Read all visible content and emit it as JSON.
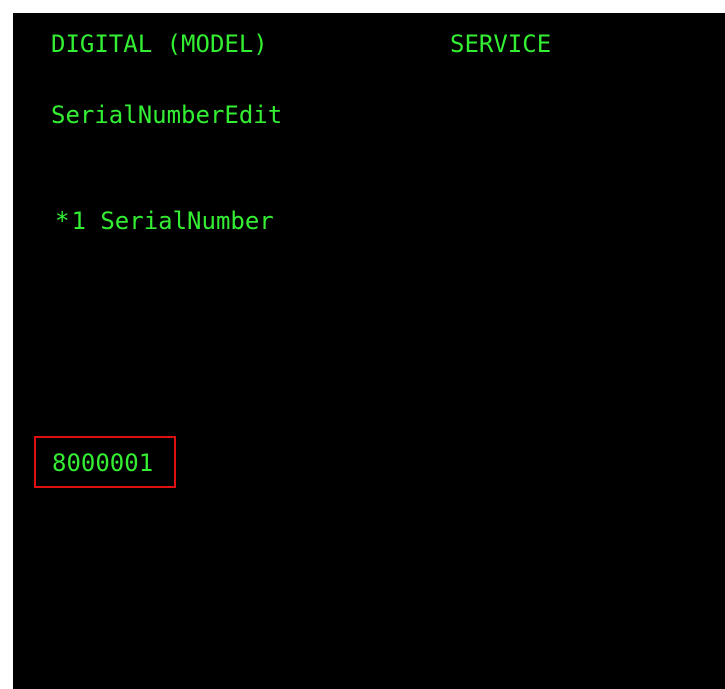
{
  "header": {
    "model": "DIGITAL (MODEL)",
    "service": "SERVICE"
  },
  "screen_title": "SerialNumberEdit",
  "menu_item": {
    "marker": "*",
    "number": "1",
    "label": "SerialNumber"
  },
  "entry": {
    "value": "8000001"
  },
  "colors": {
    "background": "#000000",
    "text": "#33ee33",
    "highlight_border": "#dd1111"
  }
}
